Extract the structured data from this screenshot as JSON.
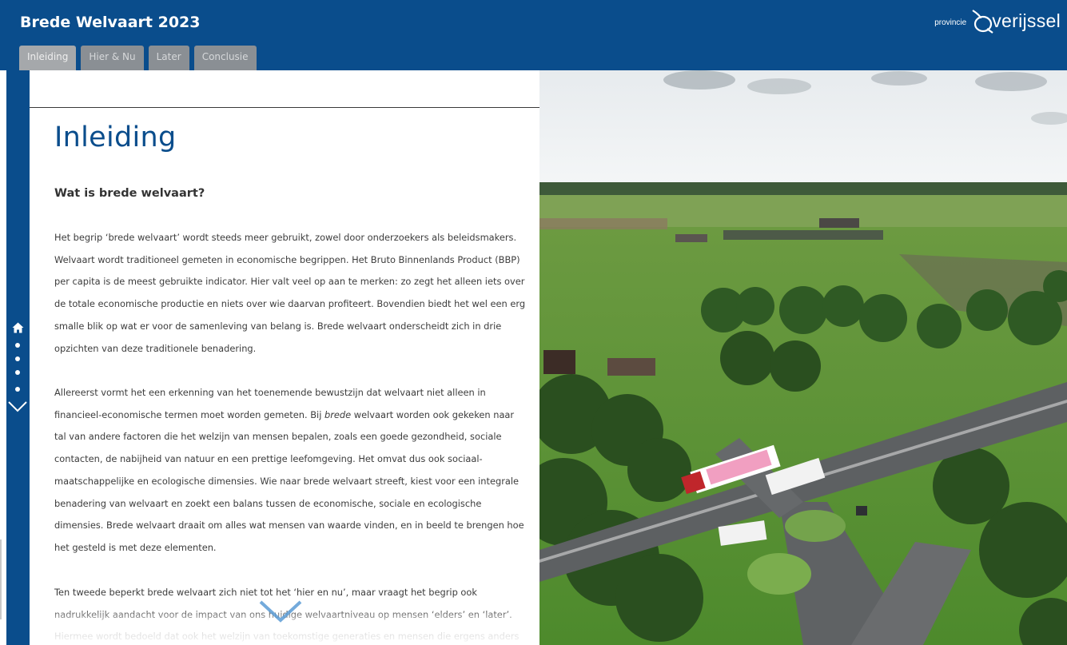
{
  "app": {
    "title": "Brede Welvaart 2023",
    "logo": {
      "small": "provincie",
      "large": "verijssel",
      "name": "provincie-overijssel-logo"
    }
  },
  "tabs": [
    {
      "label": "Inleiding",
      "active": true
    },
    {
      "label": "Hier & Nu",
      "active": false
    },
    {
      "label": "Later",
      "active": false
    },
    {
      "label": "Conclusie",
      "active": false
    }
  ],
  "sidebar": {
    "icons": [
      "home-icon",
      "nav-dot",
      "nav-dot",
      "nav-dot",
      "nav-dot",
      "chevron-down-icon"
    ]
  },
  "content": {
    "title": "Inleiding",
    "subheading": "Wat is brede welvaart?",
    "paragraphs": [
      {
        "text": "Het begrip ‘brede welvaart’ wordt steeds meer gebruikt, zowel door onderzoekers als beleidsmakers. Welvaart wordt traditioneel gemeten in economische begrippen. Het Bruto Binnenlands Product (BBP) per capita is de meest gebruikte indicator. Hier valt veel op aan te merken: zo zegt het alleen iets over de totale economische productie en niets over wie daarvan profiteert. Bovendien biedt het wel een erg smalle blik op wat er voor de samenleving van belang is. Brede welvaart onderscheidt zich in drie opzichten van deze traditionele benadering."
      },
      {
        "before": "Allereerst vormt het een erkenning van het toenemende bewustzijn dat welvaart niet alleen in financieel-economische termen moet worden gemeten. Bij ",
        "emphasis": "brede",
        "after": " welvaart worden ook gekeken naar tal van andere factoren die het welzijn van mensen bepalen, zoals een goede gezondheid, sociale contacten, de nabijheid van natuur en een prettige leefomgeving. Het omvat dus ook sociaal-maatschappelijke en ecologische dimensies. Wie naar brede welvaart streeft, kiest voor een integrale benadering van welvaart en zoekt een balans tussen de economische, sociale en ecologische dimensies. Brede welvaart draait om alles wat mensen van waarde vinden, en in beeld te brengen hoe het gesteld is met deze elementen."
      },
      {
        "text": "Ten tweede beperkt brede welvaart zich niet tot het ‘hier en nu’, maar vraagt het begrip ook nadrukkelijk aandacht voor de impact van ons huidige welvaartniveau op mensen ‘elders’ en ‘later’. Hiermee wordt bedoeld dat ook het welzijn van toekomstige generaties en mensen die ergens anders"
      }
    ]
  },
  "image": {
    "name": "aerial-road-landscape-photo"
  },
  "colors": {
    "brand": "#0a4d8c",
    "tab_inactive": "#8a8f94",
    "tab_active": "#a5a8ab",
    "text": "#3c3c3c",
    "chevron": "#5b9bd5"
  }
}
